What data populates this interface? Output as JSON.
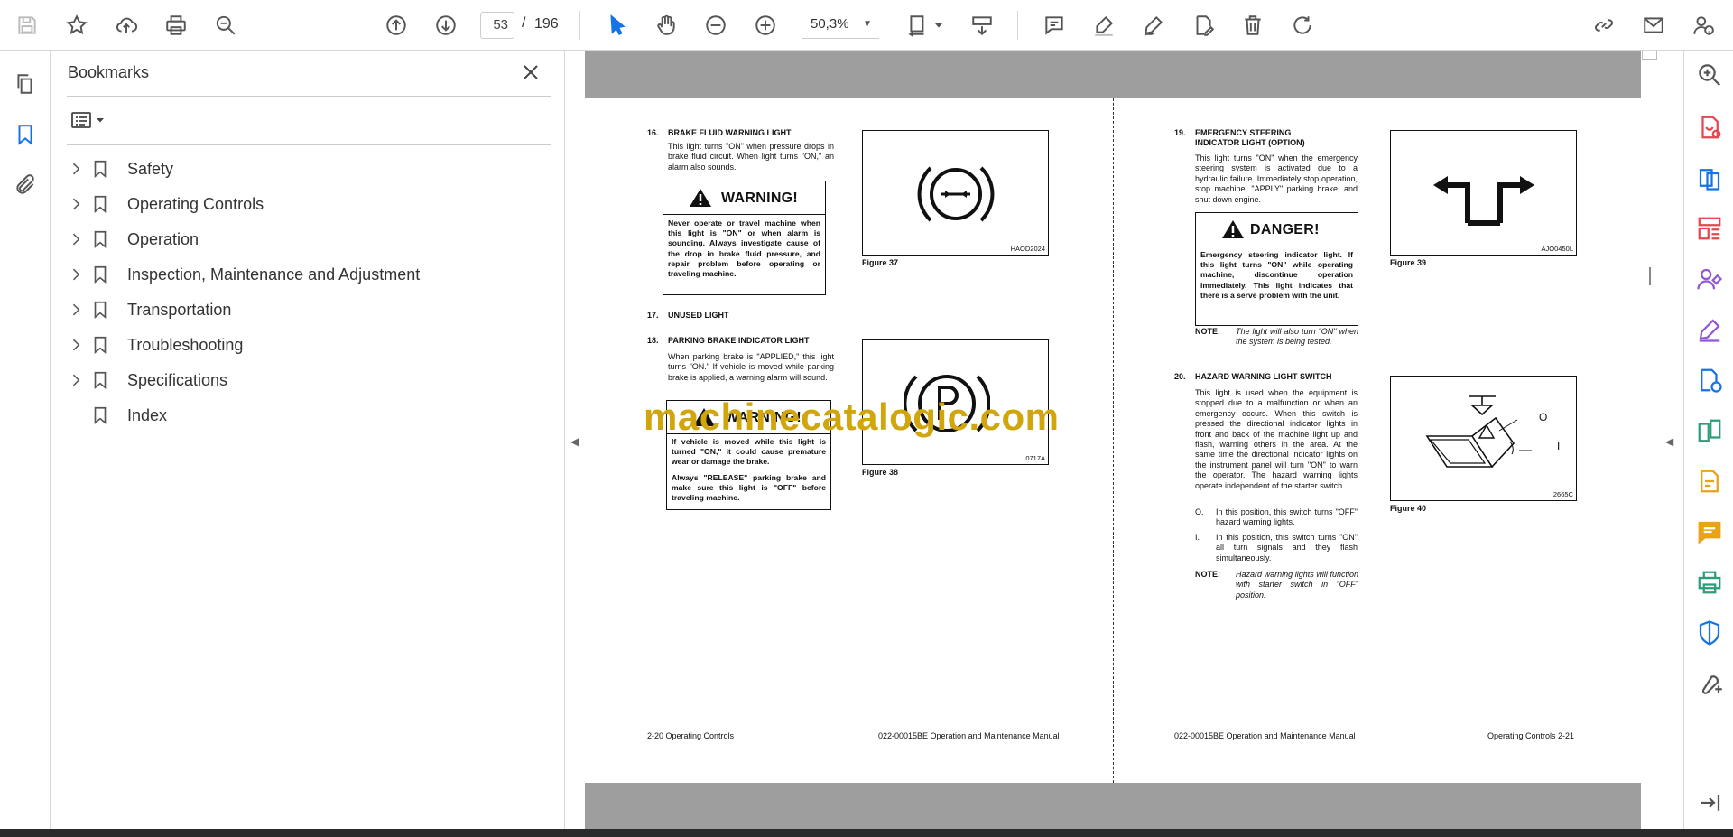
{
  "toolbar": {
    "page_current": "53",
    "page_separator": "/",
    "page_total": "196",
    "zoom": "50,3%"
  },
  "bookmarks_panel": {
    "title": "Bookmarks",
    "items": [
      {
        "label": "Safety",
        "expandable": true
      },
      {
        "label": "Operating Controls",
        "expandable": true
      },
      {
        "label": "Operation",
        "expandable": true
      },
      {
        "label": "Inspection, Maintenance and Adjustment",
        "expandable": true
      },
      {
        "label": "Transportation",
        "expandable": true
      },
      {
        "label": "Troubleshooting",
        "expandable": true
      },
      {
        "label": "Specifications",
        "expandable": true
      },
      {
        "label": "Index",
        "expandable": false
      }
    ]
  },
  "left_page": {
    "s16_num": "16.",
    "s16_title": "BRAKE FLUID WARNING LIGHT",
    "s16_body": "This light turns \"ON\" when pressure drops in brake fluid circuit. When light turns \"ON,\" an alarm also sounds.",
    "warn1_title": "WARNING!",
    "warn1_body": "Never operate or travel machine when this light is \"ON\" or when alarm is sounding. Always investigate cause of the drop in brake fluid pressure, and repair problem before operating or traveling machine.",
    "fig37_code": "HAOD2024",
    "fig37_caption": "Figure 37",
    "s17_num": "17.",
    "s17_title": "UNUSED LIGHT",
    "s18_num": "18.",
    "s18_title": "PARKING BRAKE INDICATOR LIGHT",
    "s18_body": "When parking brake is \"APPLIED,\" this light turns \"ON.\" If vehicle is moved while parking brake is applied, a warning alarm will sound.",
    "warn2_title": "WARNING!",
    "warn2_body1": "If vehicle is moved while this light is turned \"ON,\" it could cause premature wear or damage the brake.",
    "warn2_body2": "Always \"RELEASE\" parking brake and make sure this light is \"OFF\" before traveling machine.",
    "fig38_code": "0717A",
    "fig38_caption": "Figure 38",
    "footer_left": "2-20  Operating Controls",
    "footer_right": "022-00015BE Operation and Maintenance Manual"
  },
  "right_page": {
    "s19_num": "19.",
    "s19_title": "EMERGENCY STEERING INDICATOR LIGHT (OPTION)",
    "s19_body": "This light turns \"ON\" when the emergency steering system is activated due to a hydraulic failure. Immediately stop operation, stop machine, \"APPLY\" parking brake, and shut down engine.",
    "danger_title": "DANGER!",
    "danger_body": "Emergency steering indicator light. If this light turns \"ON\" while operating machine, discontinue operation immediately. This light indicates that there is a serve problem with the unit.",
    "note1_label": "NOTE:",
    "note1_body": "The light will also turn \"ON\" when the system is being tested.",
    "fig39_code": "AJO0450L",
    "fig39_caption": "Figure 39",
    "s20_num": "20.",
    "s20_title": "HAZARD WARNING LIGHT SWITCH",
    "s20_body": "This light is used when the equipment is stopped due to a malfunction or when an emergency occurs. When this switch is pressed the directional indicator lights in front and back of the machine light up and flash, warning others in the area. At the same time the directional indicator lights on the instrument panel will turn \"ON\" to warn the operator. The hazard warning lights operate independent of the starter switch.",
    "opt_o_label": "O.",
    "opt_o_body": "In this position, this switch turns \"OFF\" hazard warning lights.",
    "opt_i_label": "I.",
    "opt_i_body": "In this position, this switch turns \"ON\" all turn signals and they flash simultaneously.",
    "note2_label": "NOTE:",
    "note2_body": "Hazard warning lights will function with starter switch in \"OFF\" position.",
    "fig40_code": "2665C",
    "fig40_caption": "Figure 40",
    "fig40_label_o": "O",
    "fig40_label_i": "I",
    "footer_left": "022-00015BE Operation and Maintenance Manual",
    "footer_right": "Operating Controls 2-21"
  },
  "watermark": "machinecatalogic.com",
  "colors": {
    "accent": "#1473e6",
    "watermark": "#d0a60c",
    "page_gray": "#9e9e9e"
  }
}
